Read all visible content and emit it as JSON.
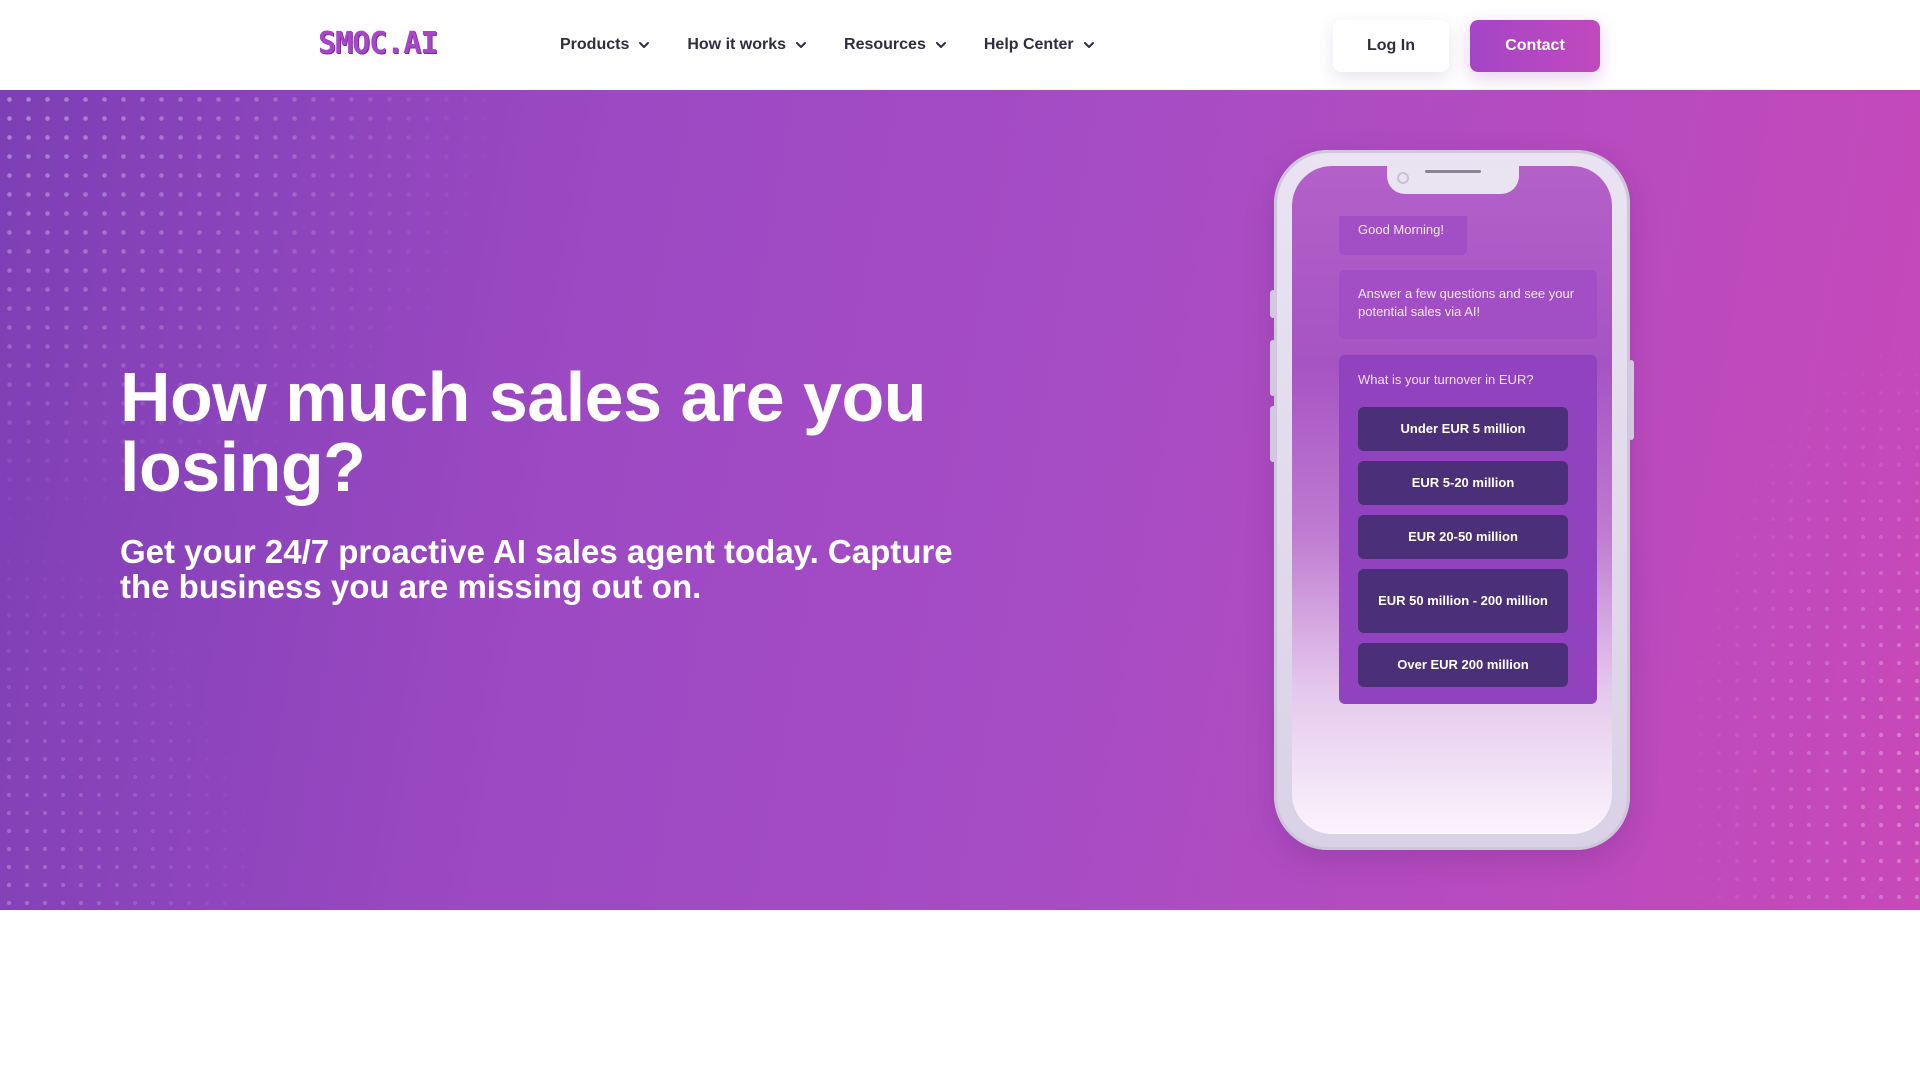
{
  "header": {
    "logo_text": "SMOC.AI",
    "nav": [
      {
        "label": "Products",
        "icon": "chevron-down-icon"
      },
      {
        "label": "How it works",
        "icon": "chevron-down-icon"
      },
      {
        "label": "Resources",
        "icon": "chevron-down-icon"
      },
      {
        "label": "Help Center",
        "icon": "chevron-down-icon"
      }
    ],
    "login_label": "Log In",
    "contact_label": "Contact"
  },
  "hero": {
    "headline": "How much sales are you losing?",
    "subheadline": "Get your 24/7 proactive AI sales agent today. Capture the business you are missing out on."
  },
  "phone": {
    "greeting": "Good Morning!",
    "intro": "Answer a few questions and see your potential sales via AI!",
    "question": "What is your turnover in EUR?",
    "options": [
      "Under EUR 5 million",
      "EUR 5-20 million",
      "EUR 20-50 million",
      "EUR 50 million - 200 million",
      "Over EUR 200 million"
    ]
  },
  "colors": {
    "brand": "#a646c8",
    "hero_start": "#7d3fb5",
    "hero_end": "#c848b8",
    "option_button": "#4b2f79"
  }
}
